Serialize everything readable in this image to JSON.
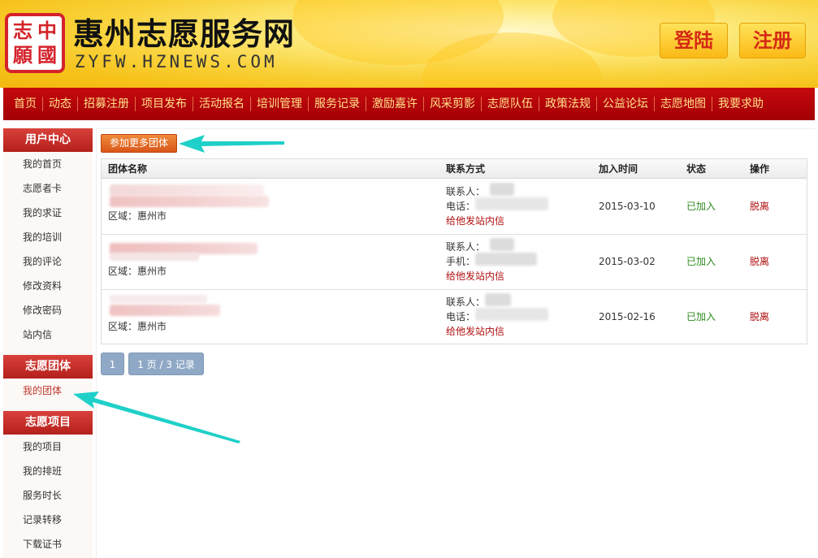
{
  "header": {
    "logo_chars": [
      "志",
      "中",
      "願",
      "國"
    ],
    "site_title": "惠州志愿服务网",
    "site_url": "ZYFW.HZNEWS.COM",
    "login_label": "登陆",
    "register_label": "注册"
  },
  "nav": [
    "首页",
    "动态",
    "招募注册",
    "项目发布",
    "活动报名",
    "培训管理",
    "服务记录",
    "激励嘉许",
    "风采剪影",
    "志愿队伍",
    "政策法规",
    "公益论坛",
    "志愿地图",
    "我要求助"
  ],
  "sidebar": {
    "user_center": {
      "title": "用户中心",
      "items": [
        "我的首页",
        "志愿者卡",
        "我的求证",
        "我的培训",
        "我的评论",
        "修改资料",
        "修改密码",
        "站内信"
      ]
    },
    "volunteer_group": {
      "title": "志愿团体",
      "items": [
        "我的团体"
      ]
    },
    "volunteer_project": {
      "title": "志愿项目",
      "items": [
        "我的项目",
        "我的排班",
        "服务时长",
        "记录转移",
        "下载证书"
      ]
    }
  },
  "main": {
    "join_more_label": "参加更多团体",
    "table": {
      "headers": {
        "name": "团体名称",
        "contact": "联系方式",
        "join_time": "加入时间",
        "status": "状态",
        "action": "操作"
      },
      "rows": [
        {
          "region": "区域：惠州市",
          "contact_person": "联系人：",
          "phone_label": "电话：",
          "send_message": "给他发站内信",
          "join_time": "2015-03-10",
          "status": "已加入",
          "action": "脱离"
        },
        {
          "region": "区域：惠州市",
          "contact_person": "联系人：",
          "phone_label": "手机：",
          "send_message": "给他发站内信",
          "join_time": "2015-03-02",
          "status": "已加入",
          "action": "脱离"
        },
        {
          "region": "区域：惠州市",
          "contact_person": "联系人：",
          "phone_label": "电话：",
          "send_message": "给他发站内信",
          "join_time": "2015-02-16",
          "status": "已加入",
          "action": "脱离"
        }
      ]
    },
    "pager": {
      "current_page": "1",
      "summary": "1 页 / 3 记录"
    }
  },
  "colors": {
    "nav_red": "#b5060a",
    "nav_text": "#ffe08a",
    "side_head": "#c6302a",
    "annotation_arrow": "#1fd0c8",
    "joined_green": "#2e8b1e",
    "link_red": "#b01010"
  }
}
